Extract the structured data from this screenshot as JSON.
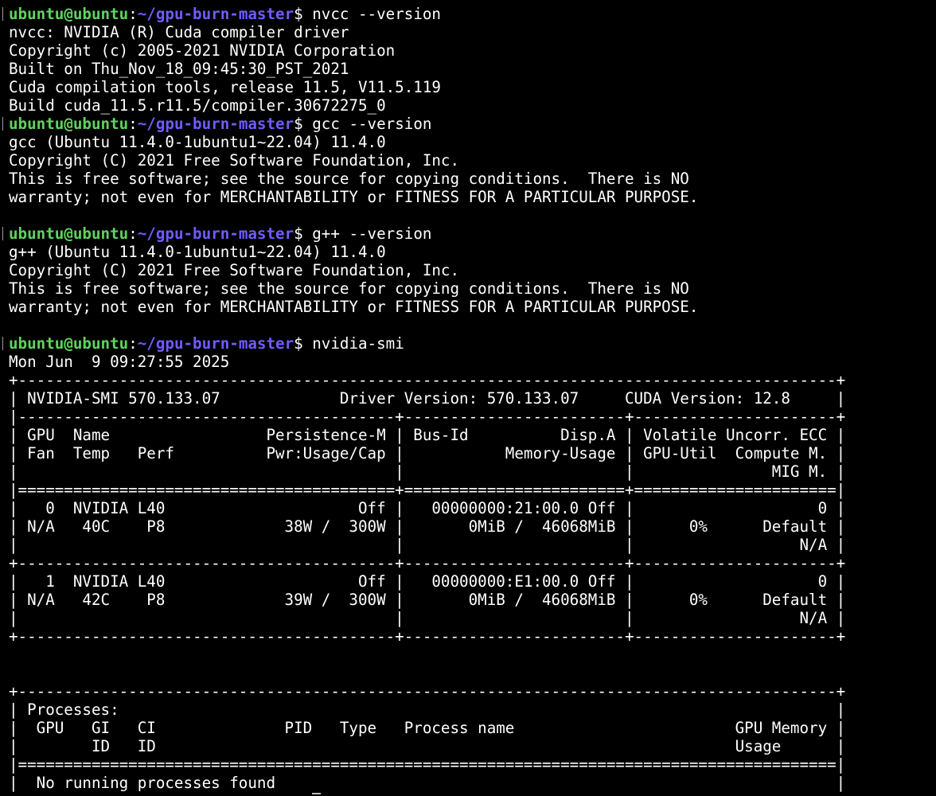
{
  "terminal": {
    "lines": [
      {
        "type": "prompt",
        "user": "ubuntu@ubuntu",
        "path": "~/gpu-burn-master",
        "cmd": "nvcc --version"
      },
      {
        "type": "out",
        "text": "nvcc: NVIDIA (R) Cuda compiler driver"
      },
      {
        "type": "out",
        "text": "Copyright (c) 2005-2021 NVIDIA Corporation"
      },
      {
        "type": "out",
        "text": "Built on Thu_Nov_18_09:45:30_PST_2021"
      },
      {
        "type": "out",
        "text": "Cuda compilation tools, release 11.5, V11.5.119"
      },
      {
        "type": "out",
        "text": "Build cuda_11.5.r11.5/compiler.30672275_0"
      },
      {
        "type": "prompt",
        "user": "ubuntu@ubuntu",
        "path": "~/gpu-burn-master",
        "cmd": "gcc --version"
      },
      {
        "type": "out",
        "text": "gcc (Ubuntu 11.4.0-1ubuntu1~22.04) 11.4.0"
      },
      {
        "type": "out",
        "text": "Copyright (C) 2021 Free Software Foundation, Inc."
      },
      {
        "type": "out",
        "text": "This is free software; see the source for copying conditions.  There is NO"
      },
      {
        "type": "out",
        "text": "warranty; not even for MERCHANTABILITY or FITNESS FOR A PARTICULAR PURPOSE."
      },
      {
        "type": "out",
        "text": ""
      },
      {
        "type": "prompt",
        "user": "ubuntu@ubuntu",
        "path": "~/gpu-burn-master",
        "cmd": "g++ --version"
      },
      {
        "type": "out",
        "text": "g++ (Ubuntu 11.4.0-1ubuntu1~22.04) 11.4.0"
      },
      {
        "type": "out",
        "text": "Copyright (C) 2021 Free Software Foundation, Inc."
      },
      {
        "type": "out",
        "text": "This is free software; see the source for copying conditions.  There is NO"
      },
      {
        "type": "out",
        "text": "warranty; not even for MERCHANTABILITY or FITNESS FOR A PARTICULAR PURPOSE."
      },
      {
        "type": "out",
        "text": ""
      },
      {
        "type": "prompt",
        "user": "ubuntu@ubuntu",
        "path": "~/gpu-burn-master",
        "cmd": "nvidia-smi"
      },
      {
        "type": "out",
        "text": "Mon Jun  9 09:27:55 2025"
      },
      {
        "type": "out",
        "text": "+-----------------------------------------------------------------------------------------+"
      },
      {
        "type": "out",
        "text": "| NVIDIA-SMI 570.133.07             Driver Version: 570.133.07     CUDA Version: 12.8     |"
      },
      {
        "type": "out",
        "text": "|-----------------------------------------+------------------------+----------------------+"
      },
      {
        "type": "out",
        "text": "| GPU  Name                 Persistence-M | Bus-Id          Disp.A | Volatile Uncorr. ECC |"
      },
      {
        "type": "out",
        "text": "| Fan  Temp   Perf          Pwr:Usage/Cap |           Memory-Usage | GPU-Util  Compute M. |"
      },
      {
        "type": "out",
        "text": "|                                         |                        |               MIG M. |"
      },
      {
        "type": "out",
        "text": "|=========================================+========================+======================|"
      },
      {
        "type": "out",
        "text": "|   0  NVIDIA L40                     Off |   00000000:21:00.0 Off |                    0 |"
      },
      {
        "type": "out",
        "text": "| N/A   40C    P8             38W /  300W |       0MiB /  46068MiB |      0%      Default |"
      },
      {
        "type": "out",
        "text": "|                                         |                        |                  N/A |"
      },
      {
        "type": "out",
        "text": "+-----------------------------------------+------------------------+----------------------+"
      },
      {
        "type": "out",
        "text": "|   1  NVIDIA L40                     Off |   00000000:E1:00.0 Off |                    0 |"
      },
      {
        "type": "out",
        "text": "| N/A   42C    P8             39W /  300W |       0MiB /  46068MiB |      0%      Default |"
      },
      {
        "type": "out",
        "text": "|                                         |                        |                  N/A |"
      },
      {
        "type": "out",
        "text": "+-----------------------------------------+------------------------+----------------------+"
      },
      {
        "type": "out",
        "text": ""
      },
      {
        "type": "out",
        "text": ""
      },
      {
        "type": "out",
        "text": "+-----------------------------------------------------------------------------------------+"
      },
      {
        "type": "out",
        "text": "| Processes:                                                                              |"
      },
      {
        "type": "out",
        "text": "|  GPU   GI   CI              PID   Type   Process name                        GPU Memory |"
      },
      {
        "type": "out",
        "text": "|        ID   ID                                                               Usage      |"
      },
      {
        "type": "out",
        "text": "|=========================================================================================|"
      },
      {
        "type": "out",
        "text": "|  No running processes found                                                             |"
      },
      {
        "type": "out",
        "text": "+-----------------------------------------------------------------------------------------+"
      }
    ],
    "colors": {
      "background": "#000000",
      "text": "#ffffff",
      "user": "#5fd35f",
      "path": "#6f5cff"
    }
  }
}
